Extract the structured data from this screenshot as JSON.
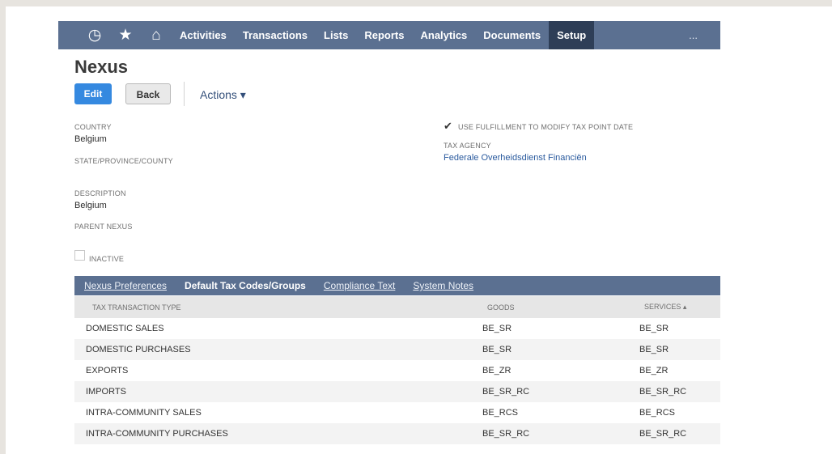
{
  "navbar": {
    "icons": [
      "recent-icon",
      "star-icon",
      "home-icon"
    ],
    "items": [
      {
        "label": "Activities"
      },
      {
        "label": "Transactions"
      },
      {
        "label": "Lists"
      },
      {
        "label": "Reports"
      },
      {
        "label": "Analytics"
      },
      {
        "label": "Documents"
      },
      {
        "label": "Setup",
        "active": true
      }
    ],
    "more": "..."
  },
  "page": {
    "title": "Nexus",
    "edit_label": "Edit",
    "back_label": "Back",
    "actions_label": "Actions ▾"
  },
  "fields": {
    "country_label": "COUNTRY",
    "country_value": "Belgium",
    "state_label": "STATE/PROVINCE/COUNTY",
    "description_label": "DESCRIPTION",
    "description_value": "Belgium",
    "parent_nexus_label": "PARENT NEXUS",
    "inactive_label": "INACTIVE",
    "inactive_checked": false,
    "use_fulfillment_label": "USE FULFILLMENT TO MODIFY TAX POINT DATE",
    "use_fulfillment_checked": true,
    "tax_agency_label": "TAX AGENCY",
    "tax_agency_value": "Federale Overheidsdienst Financiën"
  },
  "subtabs": [
    {
      "label": "Nexus Preferences",
      "active": false
    },
    {
      "label": "Default Tax Codes/Groups",
      "active": true
    },
    {
      "label": "Compliance Text",
      "active": false
    },
    {
      "label": "System Notes",
      "active": false
    }
  ],
  "table": {
    "headers": [
      "TAX TRANSACTION TYPE",
      "GOODS",
      "SERVICES ▴"
    ],
    "rows": [
      [
        "DOMESTIC SALES",
        "BE_SR",
        "BE_SR"
      ],
      [
        "DOMESTIC PURCHASES",
        "BE_SR",
        "BE_SR"
      ],
      [
        "EXPORTS",
        "BE_ZR",
        "BE_ZR"
      ],
      [
        "IMPORTS",
        "BE_SR_RC",
        "BE_SR_RC"
      ],
      [
        "INTRA-COMMUNITY SALES",
        "BE_RCS",
        "BE_RCS"
      ],
      [
        "INTRA-COMMUNITY PURCHASES",
        "BE_SR_RC",
        "BE_SR_RC"
      ]
    ]
  },
  "colors": {
    "navbar": "#5b7091",
    "navbar_active": "#2e3e57",
    "edit_button": "#3589e0",
    "link": "#2a5a9e"
  }
}
